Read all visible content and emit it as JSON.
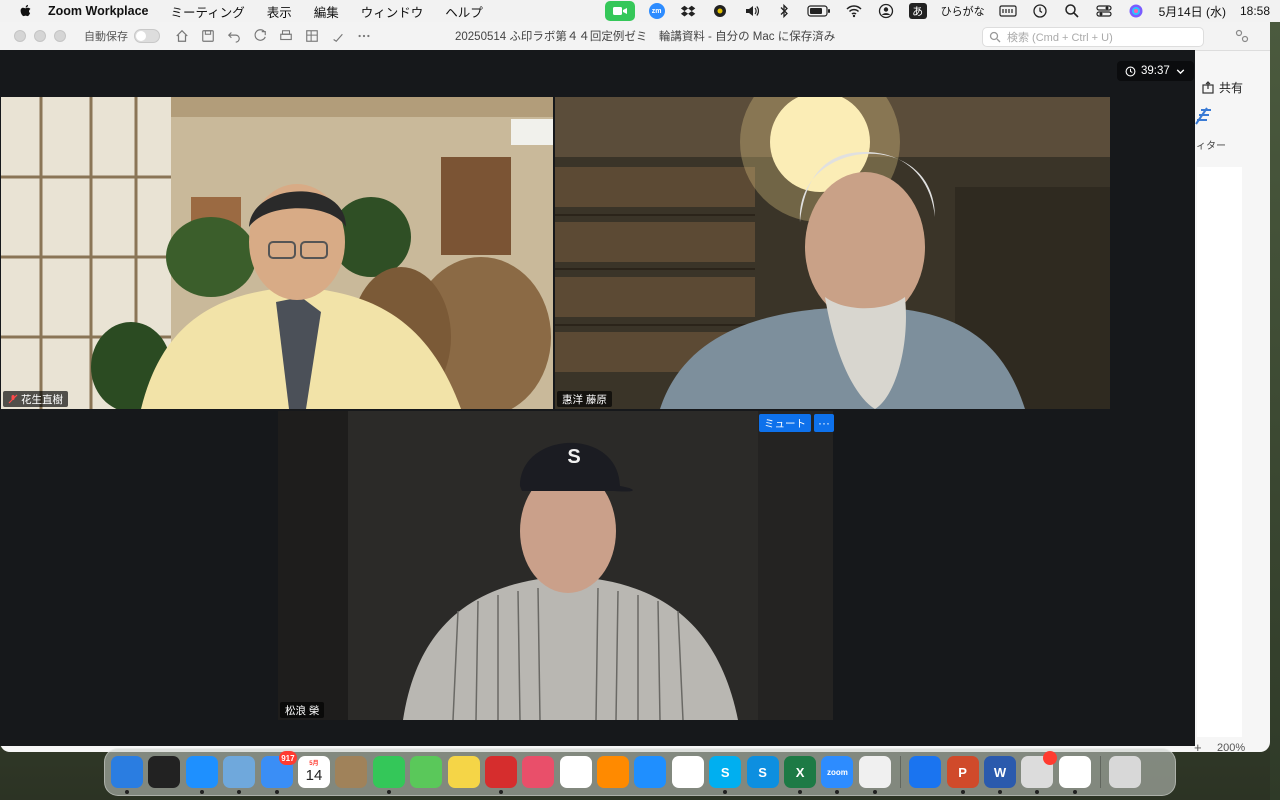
{
  "menubar": {
    "app_name": "Zoom Workplace",
    "menus": [
      "ミーティング",
      "表示",
      "編集",
      "ウィンドウ",
      "ヘルプ"
    ],
    "status": {
      "zm_label": "zm",
      "input_mode_char": "あ",
      "input_mode_label": "ひらがな",
      "date": "5月14日 (水)",
      "time": "18:58"
    }
  },
  "word": {
    "autosave_label": "自動保存",
    "document_title": "20250514 ふ印ラボ第４４回定例ゼミ　輪講資料 - 自分の Mac に保存済み",
    "search_placeholder": "検索 (Cmd + Ctrl + U)",
    "share_label": "共有",
    "ribbon_label": "ィター",
    "zoom_plus": "+",
    "zoom_level": "200%"
  },
  "meeting": {
    "timer": "39:37",
    "participants": [
      {
        "name": "花生直樹",
        "muted": true
      },
      {
        "name": "惠洋 藤原",
        "muted": false,
        "active_speaker": true
      },
      {
        "name": "松浪 榮",
        "muted": false
      }
    ],
    "tile_actions": {
      "mute_label": "ミュート",
      "more_label": "···"
    },
    "cap_letter": "S"
  },
  "dock": {
    "apps": [
      {
        "name": "Finder",
        "color": "#2a7de1",
        "running": true
      },
      {
        "name": "Mission Control",
        "color": "#222222",
        "running": false
      },
      {
        "name": "Safari",
        "color": "#1e90ff",
        "running": true
      },
      {
        "name": "Preview",
        "color": "#6fa8dc",
        "running": true
      },
      {
        "name": "Mail",
        "color": "#3a8ef6",
        "badge": "917",
        "running": true
      },
      {
        "name": "Calendar",
        "color": "#ffffff",
        "text": "14",
        "sub": "5月",
        "running": false
      },
      {
        "name": "Contacts",
        "color": "#a0825a",
        "running": false
      },
      {
        "name": "Messages",
        "color": "#34c759",
        "running": true
      },
      {
        "name": "Maps",
        "color": "#5ac85a",
        "running": false
      },
      {
        "name": "Notes",
        "color": "#f5d547",
        "running": false
      },
      {
        "name": "Photo Booth",
        "color": "#d62d2d",
        "running": true
      },
      {
        "name": "Launchpad",
        "color": "#e94f6a",
        "running": false
      },
      {
        "name": "Photos",
        "color": "#ffffff",
        "running": false
      },
      {
        "name": "Books",
        "color": "#ff8a00",
        "running": false
      },
      {
        "name": "App Store",
        "color": "#1f8fff",
        "running": false
      },
      {
        "name": "Reminders",
        "color": "#ffffff",
        "running": false
      },
      {
        "name": "Skype",
        "color": "#00aff0",
        "text": "S",
        "running": true
      },
      {
        "name": "Skype for Business",
        "color": "#0d8fe0",
        "text": "S",
        "running": false
      },
      {
        "name": "Excel",
        "color": "#1d7a45",
        "text": "X",
        "running": true
      },
      {
        "name": "Zoom",
        "color": "#2d8cff",
        "text": "zoom",
        "running": true
      },
      {
        "name": "Google Drive",
        "color": "#f0f0f0",
        "running": true
      },
      {
        "name": "Messenger",
        "color": "#1a74f0",
        "running": false
      },
      {
        "name": "PowerPoint",
        "color": "#d04a2a",
        "text": "P",
        "running": true
      },
      {
        "name": "Word",
        "color": "#2b5aad",
        "text": "W",
        "running": true
      },
      {
        "name": "Printer",
        "color": "#dcdcdc",
        "badge": "",
        "running": true
      },
      {
        "name": "Chrome",
        "color": "#ffffff",
        "running": true
      },
      {
        "name": "Trash",
        "color": "#d8d8d8",
        "running": false
      }
    ]
  },
  "colors": {
    "accent": "#0e71eb",
    "active_speaker": "#4fd44f",
    "zoom_bg": "#16181b"
  }
}
